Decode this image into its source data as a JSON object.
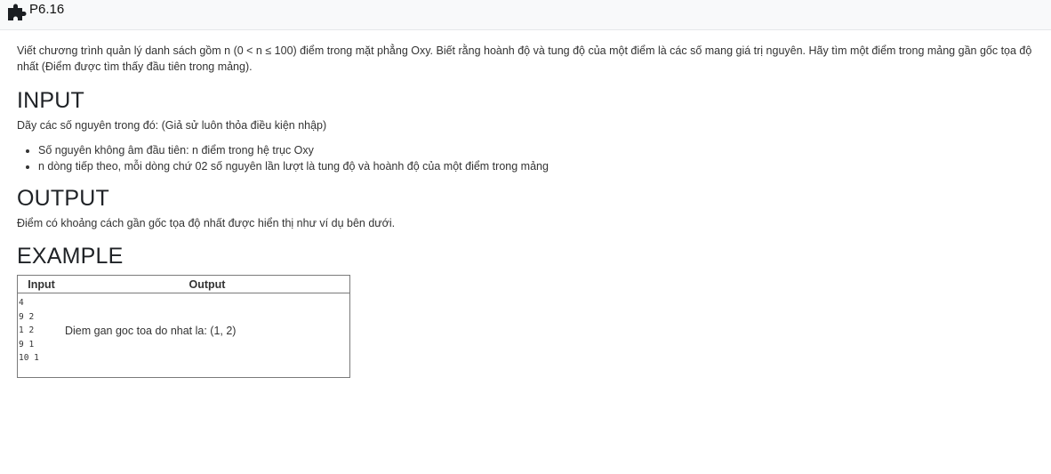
{
  "header": {
    "icon": "puzzle-icon",
    "title": "P6.16"
  },
  "problem": {
    "description": "Viết chương trình quản lý danh sách gồm n (0 < n ≤ 100) điểm trong mặt phẳng Oxy. Biết rằng hoành độ và tung độ của một điểm là các số mang giá trị nguyên. Hãy tìm một điểm trong mảng gần gốc tọa độ nhất (Điểm được tìm thấy đầu tiên trong mảng).",
    "input_heading": "INPUT",
    "input_intro": "Dãy các số nguyên trong đó: (Giả sử luôn thỏa điều kiện nhập)",
    "input_items": [
      "Số nguyên không âm đầu tiên: n điểm trong hệ trục Oxy",
      "n dòng tiếp theo, mỗi dòng chứ 02 số nguyên lần lượt là tung độ và hoành độ của một điểm trong mảng"
    ],
    "output_heading": "OUTPUT",
    "output_text": "Điểm có khoảng cách gần gốc tọa độ nhất được hiển thị như ví dụ bên dưới.",
    "example_heading": "EXAMPLE"
  },
  "example_table": {
    "headers": [
      "Input",
      "Output"
    ],
    "input": "4\n9 2\n1 2\n9 1\n10 1",
    "output": "Diem gan goc toa do nhat la: (1, 2)"
  }
}
